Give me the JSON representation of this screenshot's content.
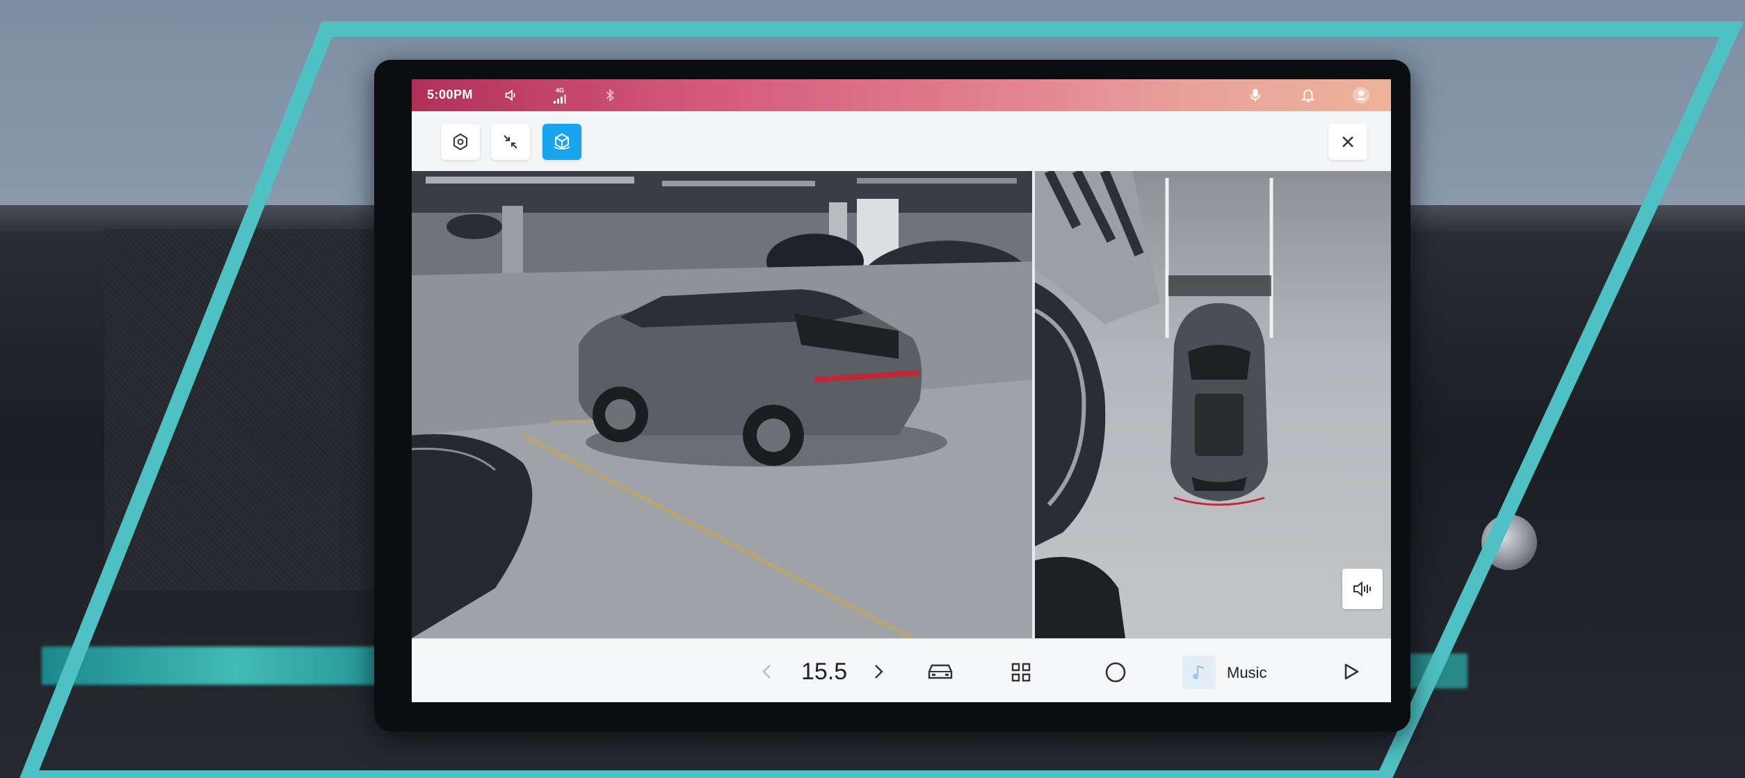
{
  "status_bar": {
    "time": "5:00PM",
    "signal_label": "4G"
  },
  "dock": {
    "temperature": "15.5",
    "media_label": "Music"
  },
  "colors": {
    "frame": "#4fc0c4",
    "accent_active": "#1aa4f0",
    "status_gradient_start": "#b0305a",
    "status_gradient_end": "#ecb39a"
  },
  "icons": {
    "settings": "settings-icon",
    "minimize": "minimize-icon",
    "view_3d": "view-3d-icon",
    "close": "close-icon",
    "volume": "volume-icon",
    "signal": "signal-icon",
    "bluetooth": "bluetooth-icon",
    "microphone": "microphone-icon",
    "notification": "notification-icon",
    "profile": "profile-icon",
    "car": "car-icon",
    "apps": "apps-grid-icon",
    "home": "home-icon",
    "play": "play-icon",
    "sound_toggle": "speaker-icon"
  }
}
